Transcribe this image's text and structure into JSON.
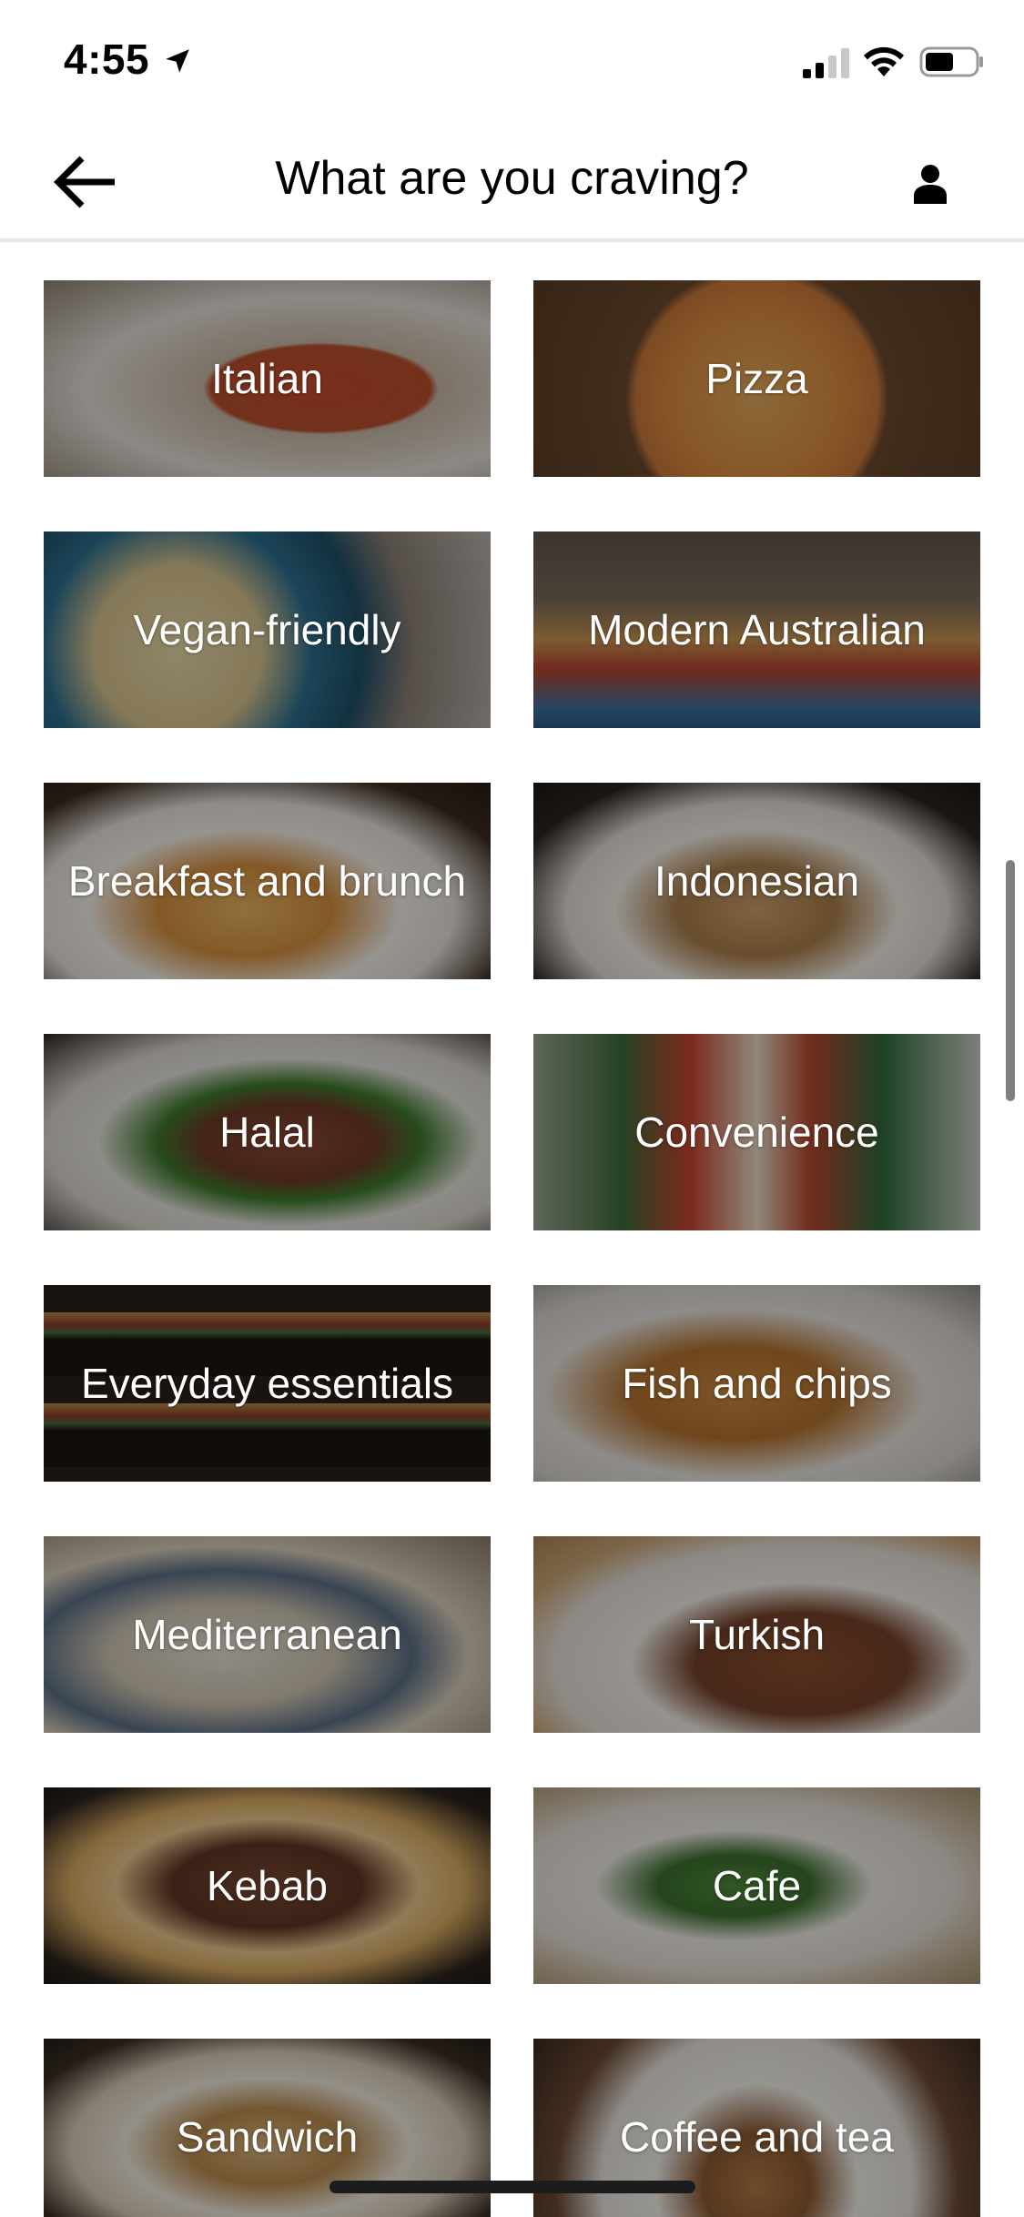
{
  "status_bar": {
    "time": "4:55",
    "icons": [
      "location-arrow-icon",
      "cellular-signal-icon",
      "wifi-icon",
      "battery-icon"
    ],
    "battery_level": 0.55
  },
  "header": {
    "title": "What are you craving?",
    "back_icon": "back-arrow-icon",
    "profile_icon": "person-icon"
  },
  "categories": [
    {
      "label": "Italian"
    },
    {
      "label": "Pizza"
    },
    {
      "label": "Vegan-friendly"
    },
    {
      "label": "Modern Australian"
    },
    {
      "label": "Breakfast and brunch"
    },
    {
      "label": "Indonesian"
    },
    {
      "label": "Halal"
    },
    {
      "label": "Convenience"
    },
    {
      "label": "Everyday essentials"
    },
    {
      "label": "Fish and chips"
    },
    {
      "label": "Mediterranean"
    },
    {
      "label": "Turkish"
    },
    {
      "label": "Kebab"
    },
    {
      "label": "Cafe"
    },
    {
      "label": "Sandwich"
    },
    {
      "label": "Coffee and tea"
    }
  ],
  "colors": {
    "text": "#000000",
    "tile_label": "#ffffff",
    "divider": "#e6e6e6"
  }
}
